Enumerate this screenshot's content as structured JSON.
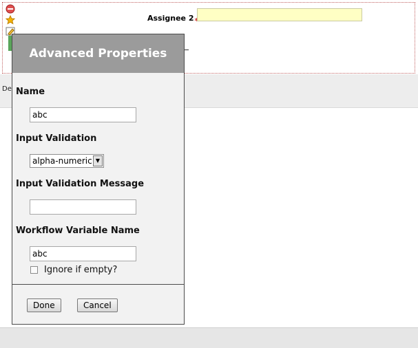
{
  "form": {
    "assignee_label": "Assignee 2",
    "required_mark": "*",
    "assignee_value": "",
    "toolbar_fragment": "Des"
  },
  "dialog": {
    "title": "Advanced Properties",
    "name_label": "Name",
    "name_value": "abc",
    "validation_label": "Input Validation",
    "validation_selected": "alpha-numeric",
    "validation_message_label": "Input Validation Message",
    "validation_message_value": "",
    "workflow_var_label": "Workflow Variable Name",
    "workflow_var_value": "abc",
    "ignore_empty_label": "Ignore if empty?",
    "ignore_empty_checked": false,
    "done_label": "Done",
    "cancel_label": "Cancel"
  },
  "icons": [
    "remove-icon",
    "star-icon",
    "edit-icon",
    "green-marker-icon"
  ],
  "colors": {
    "dialog_header": "#9b9b9b",
    "dialog_bg": "#f2f2f2",
    "required_input_bg": "#ffffc4",
    "required_star": "#d03030"
  }
}
